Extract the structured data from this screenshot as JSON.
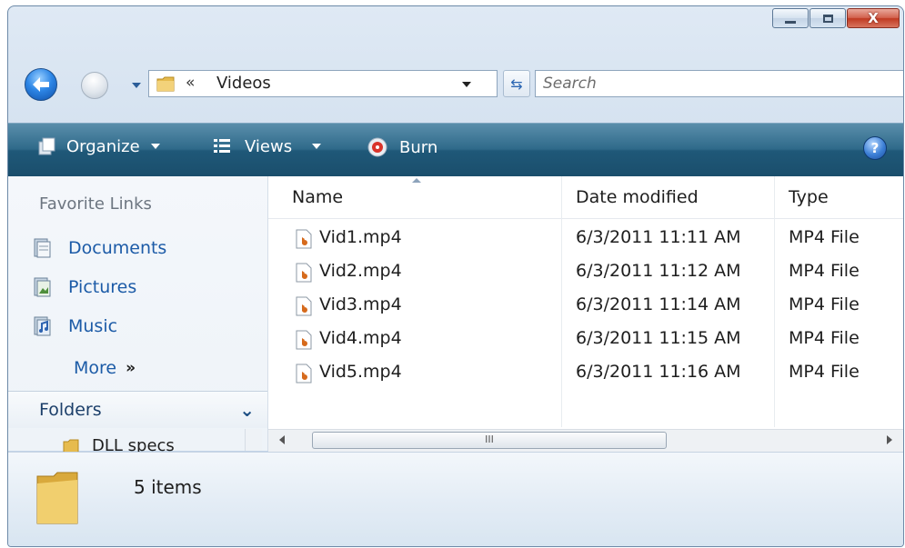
{
  "titlebar": {
    "buttons": [
      "minimize-icon",
      "maximize-icon",
      "close-icon"
    ]
  },
  "nav": {
    "address_chevron": "«",
    "address": "Videos",
    "search_placeholder": "Search"
  },
  "toolbar": {
    "organize": "Organize",
    "views": "Views",
    "burn": "Burn",
    "help": "?"
  },
  "sidebar": {
    "favorite_links_title": "Favorite Links",
    "links": [
      {
        "label": "Documents",
        "icon": "documents-icon"
      },
      {
        "label": "Pictures",
        "icon": "pictures-icon"
      },
      {
        "label": "Music",
        "icon": "music-icon"
      }
    ],
    "more": "More",
    "more_chevron": "»",
    "folders_label": "Folders",
    "folder_items": [
      "DLL specs"
    ]
  },
  "columns": {
    "name": "Name",
    "date": "Date modified",
    "type": "Type"
  },
  "files": [
    {
      "name": "Vid1.mp4",
      "date": "6/3/2011 11:11 AM",
      "type": "MP4 File"
    },
    {
      "name": "Vid2.mp4",
      "date": "6/3/2011 11:12 AM",
      "type": "MP4 File"
    },
    {
      "name": "Vid3.mp4",
      "date": "6/3/2011 11:14 AM",
      "type": "MP4 File"
    },
    {
      "name": "Vid4.mp4",
      "date": "6/3/2011 11:15 AM",
      "type": "MP4 File"
    },
    {
      "name": "Vid5.mp4",
      "date": "6/3/2011 11:16 AM",
      "type": "MP4 File"
    }
  ],
  "scrollbar": {
    "grip": "III"
  },
  "details": {
    "count": "5 items"
  },
  "colors": {
    "toolbar": "#1f5878",
    "link": "#1c5ba7",
    "folder": "#e9c25a"
  }
}
